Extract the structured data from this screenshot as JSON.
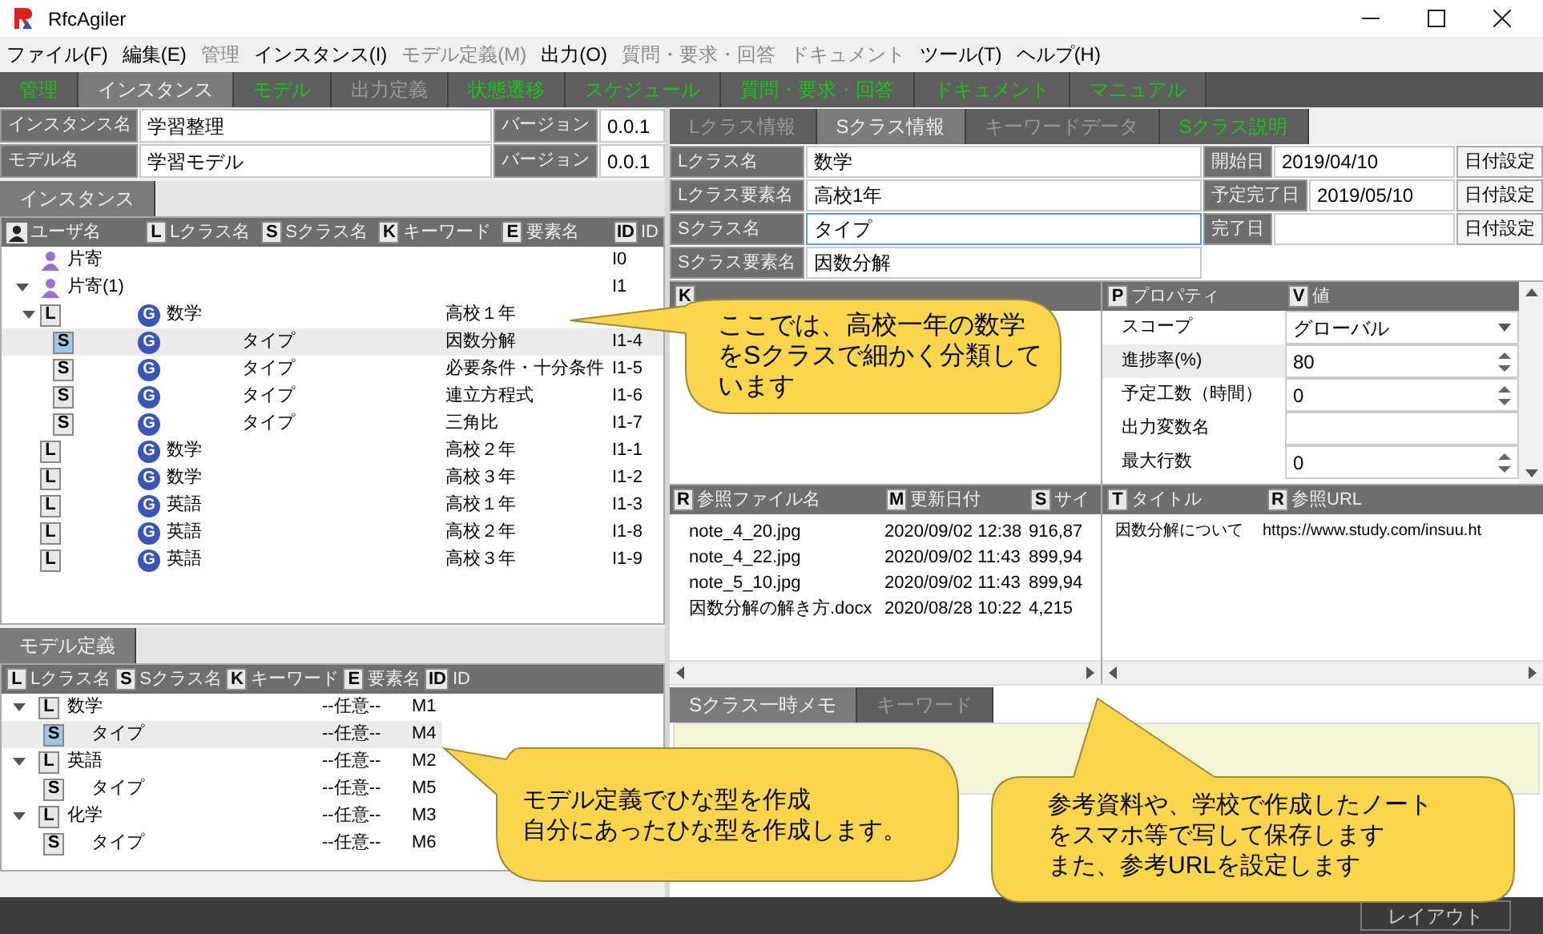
{
  "window": {
    "title": "RfcAgiler"
  },
  "menu": [
    {
      "label": "ファイル(F)",
      "disabled": false
    },
    {
      "label": "編集(E)",
      "disabled": false
    },
    {
      "label": "管理",
      "disabled": true
    },
    {
      "label": "インスタンス(I)",
      "disabled": false
    },
    {
      "label": "モデル定義(M)",
      "disabled": true
    },
    {
      "label": "出力(O)",
      "disabled": false
    },
    {
      "label": "質問・要求・回答",
      "disabled": true
    },
    {
      "label": "ドキュメント",
      "disabled": true
    },
    {
      "label": "ツール(T)",
      "disabled": false
    },
    {
      "label": "ヘルプ(H)",
      "disabled": false
    }
  ],
  "main_tabs": [
    {
      "label": "管理",
      "selected": false,
      "enabled": true
    },
    {
      "label": "インスタンス",
      "selected": true,
      "enabled": true
    },
    {
      "label": "モデル",
      "selected": false,
      "enabled": true
    },
    {
      "label": "出力定義",
      "selected": false,
      "enabled": false
    },
    {
      "label": "状態遷移",
      "selected": false,
      "enabled": true
    },
    {
      "label": "スケジュール",
      "selected": false,
      "enabled": true
    },
    {
      "label": "質問・要求・回答",
      "selected": false,
      "enabled": true
    },
    {
      "label": "ドキュメント",
      "selected": false,
      "enabled": true
    },
    {
      "label": "マニュアル",
      "selected": false,
      "enabled": true
    }
  ],
  "instance_form": [
    {
      "label": "インスタンス名",
      "value": "学習整理",
      "version_label": "バージョン",
      "version": "0.0.1"
    },
    {
      "label": "モデル名",
      "value": "学習モデル",
      "version_label": "バージョン",
      "version": "0.0.1"
    }
  ],
  "instance_tabs": [
    {
      "label": "インスタンス",
      "selected": true,
      "enabled": true
    }
  ],
  "instance_tree": {
    "columns": [
      {
        "label": "ユーザ名"
      },
      {
        "tag": "L",
        "label": "Lクラス名"
      },
      {
        "tag": "S",
        "label": "Sクラス名"
      },
      {
        "tag": "K",
        "label": "キーワード"
      },
      {
        "tag": "E",
        "label": "要素名"
      },
      {
        "tag": "ID",
        "label": "ID"
      }
    ],
    "rows": [
      {
        "kind": "user",
        "name": "片寄",
        "id": "I0",
        "selected": false
      },
      {
        "kind": "user",
        "name": "片寄(1)",
        "id": "I1",
        "selected": false,
        "expanded": true,
        "children": [
          {
            "kind": "class",
            "tag": "L",
            "scope": "G",
            "lclass": "数学",
            "element": "高校１年",
            "selected": false,
            "expanded": true,
            "children": [
              {
                "kind": "class",
                "tag": "S",
                "scope": "G",
                "sclass": "タイプ",
                "element": "因数分解",
                "id": "I1-4",
                "selected": true
              },
              {
                "kind": "class",
                "tag": "S",
                "scope": "G",
                "sclass": "タイプ",
                "element": "必要条件・十分条件",
                "id": "I1-5",
                "selected": false
              },
              {
                "kind": "class",
                "tag": "S",
                "scope": "G",
                "sclass": "タイプ",
                "element": "連立方程式",
                "id": "I1-6",
                "selected": false
              },
              {
                "kind": "class",
                "tag": "S",
                "scope": "G",
                "sclass": "タイプ",
                "element": "三角比",
                "id": "I1-7",
                "selected": false
              }
            ]
          },
          {
            "kind": "class",
            "tag": "L",
            "scope": "G",
            "lclass": "数学",
            "element": "高校２年",
            "id": "I1-1",
            "selected": false
          },
          {
            "kind": "class",
            "tag": "L",
            "scope": "G",
            "lclass": "数学",
            "element": "高校３年",
            "id": "I1-2",
            "selected": false
          },
          {
            "kind": "class",
            "tag": "L",
            "scope": "G",
            "lclass": "英語",
            "element": "高校１年",
            "id": "I1-3",
            "selected": false
          },
          {
            "kind": "class",
            "tag": "L",
            "scope": "G",
            "lclass": "英語",
            "element": "高校２年",
            "id": "I1-8",
            "selected": false
          },
          {
            "kind": "class",
            "tag": "L",
            "scope": "G",
            "lclass": "英語",
            "element": "高校３年",
            "id": "I1-9",
            "selected": false
          }
        ]
      }
    ]
  },
  "model_tabs": [
    {
      "label": "モデル定義",
      "selected": true,
      "enabled": true
    }
  ],
  "model_tree": {
    "columns": [
      {
        "tag": "L",
        "label": "Lクラス名"
      },
      {
        "tag": "S",
        "label": "Sクラス名"
      },
      {
        "tag": "K",
        "label": "キーワード"
      },
      {
        "tag": "E",
        "label": "要素名"
      },
      {
        "tag": "ID",
        "label": "ID"
      }
    ],
    "rows": [
      {
        "tag": "L",
        "name": "数学",
        "element": "--任意--",
        "id": "M1",
        "selected": false,
        "expanded": true,
        "children": [
          {
            "tag": "S",
            "name": "タイプ",
            "element": "--任意--",
            "id": "M4",
            "selected": true
          }
        ]
      },
      {
        "tag": "L",
        "name": "英語",
        "element": "--任意--",
        "id": "M2",
        "selected": false,
        "expanded": true,
        "children": [
          {
            "tag": "S",
            "name": "タイプ",
            "element": "--任意--",
            "id": "M5",
            "selected": false
          }
        ]
      },
      {
        "tag": "L",
        "name": "化学",
        "element": "--任意--",
        "id": "M3",
        "selected": false,
        "expanded": true,
        "children": [
          {
            "tag": "S",
            "name": "タイプ",
            "element": "--任意--",
            "id": "M6",
            "selected": false
          }
        ]
      }
    ]
  },
  "detail_tabs": [
    {
      "label": "Lクラス情報",
      "selected": false,
      "enabled": false
    },
    {
      "label": "Sクラス情報",
      "selected": true,
      "enabled": true
    },
    {
      "label": "キーワードデータ",
      "selected": false,
      "enabled": false
    },
    {
      "label": "Sクラス説明",
      "selected": false,
      "enabled": true
    }
  ],
  "detail_form": [
    {
      "label": "Lクラス名",
      "value": "数学",
      "focused": false,
      "date_label": "開始日",
      "date": "2019/04/10",
      "button": "日付設定"
    },
    {
      "label": "Lクラス要素名",
      "value": "高校1年",
      "focused": false,
      "date_label": "予定完了日",
      "date": "2019/05/10",
      "button": "日付設定"
    },
    {
      "label": "Sクラス名",
      "value": "タイプ",
      "focused": true,
      "date_label": "完了日",
      "button": "日付設定"
    },
    {
      "label": "Sクラス要素名",
      "value": "因数分解",
      "focused": false
    }
  ],
  "keyword_table": {
    "columns": [
      {
        "tag": "K"
      }
    ]
  },
  "properties": {
    "columns": [
      {
        "tag": "P",
        "label": "プロパティ"
      },
      {
        "tag": "V",
        "label": "値"
      }
    ],
    "rows": [
      {
        "kind": "dropdown",
        "name": "スコープ",
        "value": "グローバル",
        "selected": false
      },
      {
        "kind": "spinner",
        "name": "進捗率(%)",
        "value": "80",
        "selected": true
      },
      {
        "kind": "spinner",
        "name": "予定工数（時間）",
        "value": "0",
        "selected": false
      },
      {
        "kind": "text",
        "name": "出力変数名",
        "selected": false
      },
      {
        "kind": "spinner",
        "name": "最大行数",
        "value": "0",
        "selected": false
      }
    ]
  },
  "files_table": {
    "columns": [
      {
        "tag": "R",
        "label": "参照ファイル名"
      },
      {
        "tag": "M",
        "label": "更新日付"
      },
      {
        "tag": "S",
        "label": "サイ"
      }
    ],
    "rows": [
      [
        "note_4_20.jpg",
        "2020/09/02 12:38",
        "916,87"
      ],
      [
        "note_4_22.jpg",
        "2020/09/02 11:43",
        "899,94"
      ],
      [
        "note_5_10.jpg",
        "2020/09/02 11:43",
        "899,94"
      ],
      [
        "因数分解の解き方.docx",
        "2020/08/28 10:22",
        "4,215"
      ]
    ]
  },
  "url_table": {
    "columns": [
      {
        "tag": "T",
        "label": "タイトル"
      },
      {
        "tag": "R",
        "label": "参照URL"
      }
    ],
    "rows": [
      [
        "因数分解について",
        "https://www.study.com/insuu.ht"
      ]
    ]
  },
  "memo_tabs": [
    {
      "label": "Sクラス一時メモ",
      "selected": true,
      "enabled": true
    },
    {
      "label": "キーワード",
      "selected": false,
      "enabled": false
    }
  ],
  "callouts": [
    {
      "lines": [
        "ここでは、高校一年の数学",
        "をSクラスで細かく分類して",
        "います"
      ]
    },
    {
      "lines": [
        "モデル定義でひな型を作成",
        "自分にあったひな型を作成します。"
      ]
    },
    {
      "lines": [
        "参考資料や、学校で作成したノート",
        "をスマホ等で写して保存します",
        "また、参考URLを設定します"
      ]
    }
  ],
  "status_bar": {
    "button": "レイアウト"
  }
}
